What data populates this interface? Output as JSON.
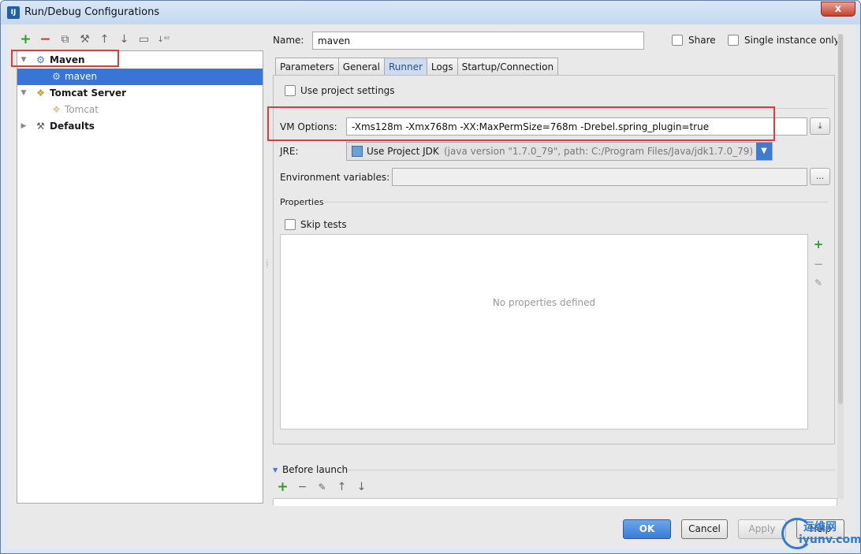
{
  "window": {
    "title": "Run/Debug Configurations",
    "close_glyph": "x"
  },
  "left_toolbar": {
    "icons": [
      {
        "name": "add-icon",
        "glyph": "+"
      },
      {
        "name": "remove-icon",
        "glyph": "−"
      },
      {
        "name": "copy-icon",
        "glyph": "⧉"
      },
      {
        "name": "wrench-icon",
        "glyph": "⚒"
      },
      {
        "name": "move-up-icon",
        "glyph": "↑"
      },
      {
        "name": "move-down-icon",
        "glyph": "↓"
      },
      {
        "name": "folder-icon",
        "glyph": "▭"
      },
      {
        "name": "sort-icon",
        "glyph": "↓ᵃᶻ"
      }
    ]
  },
  "tree": {
    "items": [
      {
        "label": "Maven",
        "level": 0,
        "bold": true,
        "expanded": true,
        "icon": "gear-icon"
      },
      {
        "label": "maven",
        "level": 1,
        "selected": true,
        "icon": "gear-icon"
      },
      {
        "label": "Tomcat Server",
        "level": 0,
        "bold": true,
        "expanded": true,
        "icon": "tomcat-icon"
      },
      {
        "label": "Tomcat",
        "level": 1,
        "muted": true,
        "icon": "tomcat-icon"
      },
      {
        "label": "Defaults",
        "level": 0,
        "bold": true,
        "expanded": false,
        "icon": "wrench-icon"
      }
    ]
  },
  "form": {
    "name_label": "Name:",
    "name_value": "maven",
    "share_label": "Share",
    "single_instance_label": "Single instance only"
  },
  "tabs": [
    "Parameters",
    "General",
    "Runner",
    "Logs",
    "Startup/Connection"
  ],
  "active_tab": "Runner",
  "runner": {
    "use_project_settings": "Use project settings",
    "vm_options_label": "VM Options:",
    "vm_options_value": "-Xms128m -Xmx768m -XX:MaxPermSize=768m -Drebel.spring_plugin=true",
    "jre_label": "JRE:",
    "jre_value": "Use Project JDK",
    "jre_detail": "(java version \"1.7.0_79\", path: C:/Program Files/Java/jdk1.7.0_79)",
    "env_label": "Environment variables:",
    "env_button": "...",
    "properties_label": "Properties",
    "skip_tests_label": "Skip tests",
    "no_properties": "No properties defined"
  },
  "before_launch": {
    "label": "Before launch"
  },
  "buttons": {
    "ok": "OK",
    "cancel": "Cancel",
    "apply": "Apply",
    "help": "Help"
  },
  "watermark": {
    "top": "运维网",
    "bottom": "iyunv.com"
  },
  "colors": {
    "selection": "#3875d7",
    "highlight_box": "#e23b3b",
    "ok_button": "#3a7bd5"
  }
}
